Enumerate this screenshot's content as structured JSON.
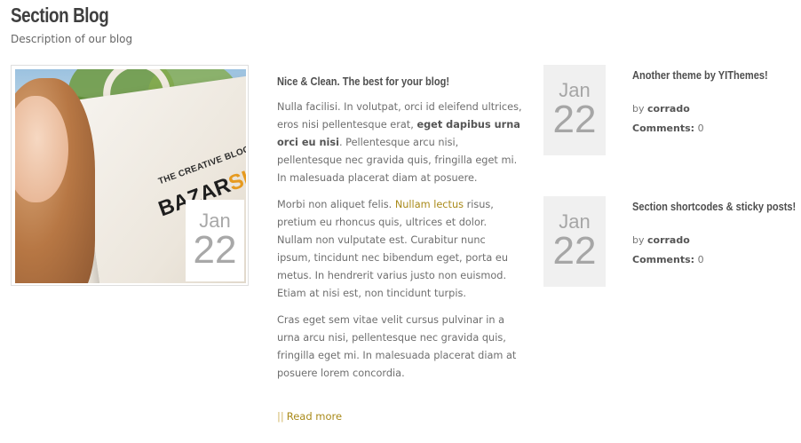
{
  "section": {
    "title": "Section Blog",
    "description": "Description of our blog"
  },
  "featured": {
    "image_text_line1": "THE CREATIVE BLOG OF",
    "image_text_bazar": "BAZAR",
    "image_text_shop": "SHOP",
    "date_month": "Jan",
    "date_day": "22"
  },
  "main_post": {
    "title": "Nice & Clean. The best for your blog!",
    "p1_plain": "Nulla facilisi. In volutpat, orci id eleifend ultrices, eros nisi pellentesque erat, ",
    "p1_bold": "eget dapibus urna orci eu nisi",
    "p1_rest": ". Pellentesque arcu nisi, pellentesque nec gravida quis, fringilla eget mi. In malesuada placerat diam at posuere.",
    "p2_plain": "Morbi non aliquet felis. ",
    "p2_link": "Nullam lectus",
    "p2_rest": " risus, pretium eu rhoncus quis, ultrices et dolor. Nullam non vulputate est. Curabitur nunc ipsum, tincidunt nec bibendum eget, porta eu metus. In hendrerit varius justo non euismod. Etiam at nisi est, non tincidunt turpis.",
    "p3": "Cras eget sem vitae velit cursus pulvinar in a urna arcu nisi, pellentesque nec gravida quis, fringilla eget mi. In malesuada placerat diam at posuere lorem concordia.",
    "read_more_bars": "||",
    "read_more": "Read more"
  },
  "side_posts": [
    {
      "date_month": "Jan",
      "date_day": "22",
      "title": "Another theme by YIThemes!",
      "by_label": "by",
      "author": "corrado",
      "comments_label": "Comments:",
      "comments_count": "0"
    },
    {
      "date_month": "Jan",
      "date_day": "22",
      "title": "Section shortcodes & sticky posts!",
      "by_label": "by",
      "author": "corrado",
      "comments_label": "Comments:",
      "comments_count": "0"
    }
  ],
  "colors": {
    "link": "#a98a1a",
    "date_box_bg": "#f0f0f0",
    "date_text": "#a6a6a6"
  }
}
